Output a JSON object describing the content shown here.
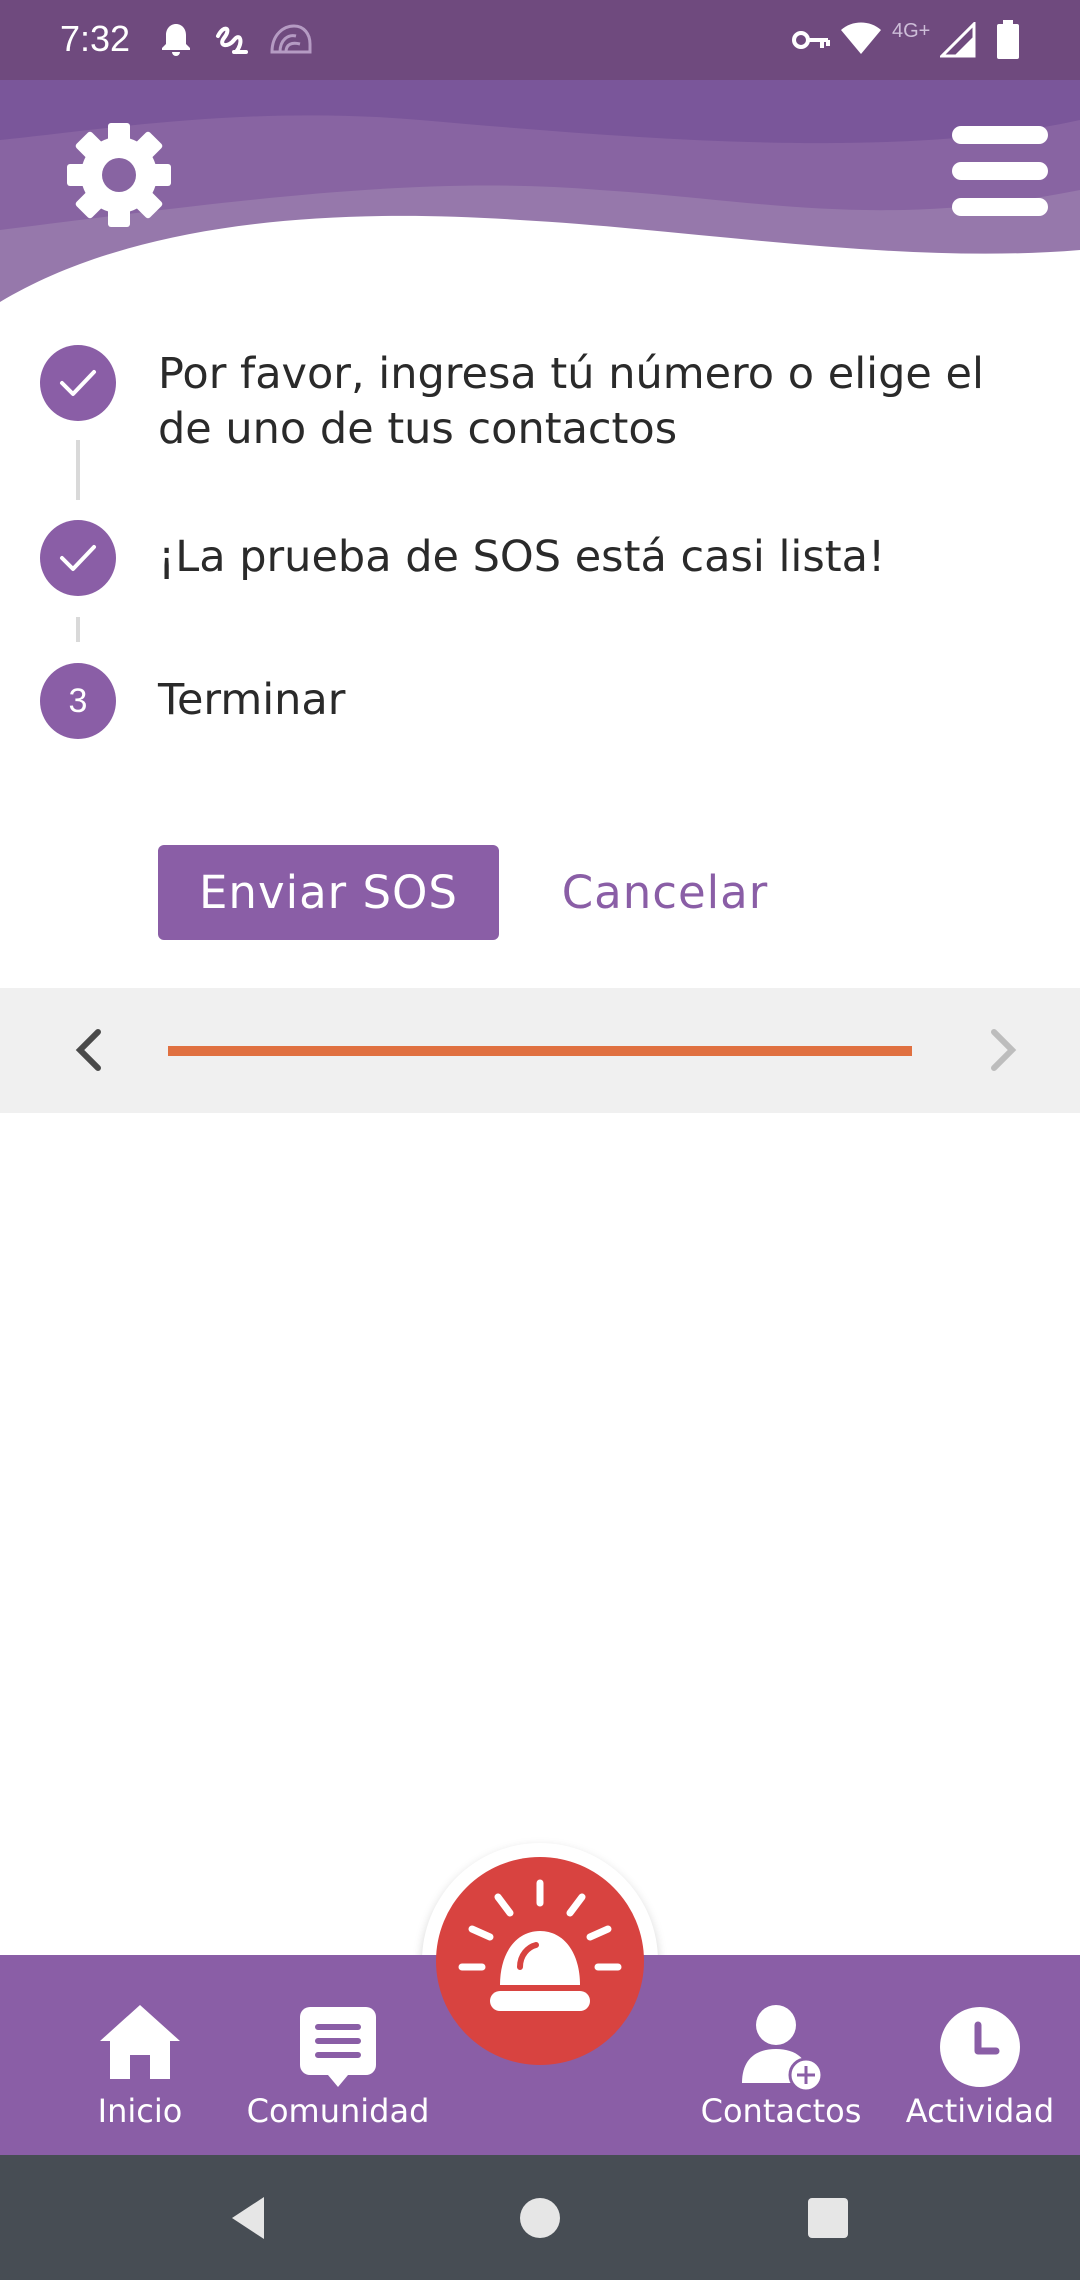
{
  "status_bar": {
    "time": "7:32",
    "network_label": "4G+",
    "icons": [
      "bell-icon",
      "squiggle-icon",
      "shell-icon",
      "vpn-key-icon",
      "wifi-icon",
      "signal-icon",
      "battery-icon"
    ]
  },
  "header": {
    "settings_icon": "gear-icon",
    "menu_icon": "hamburger-menu-icon",
    "colors": {
      "primary": "#8a5ea6",
      "status_bar": "#6f4a7e"
    }
  },
  "steps": [
    {
      "marker": "check",
      "label": "Por favor, ingresa tú número o elige el de uno de tus contactos"
    },
    {
      "marker": "check",
      "label": "¡La prueba de SOS está casi lista!"
    },
    {
      "marker": "3",
      "label": "Terminar"
    }
  ],
  "actions": {
    "send_label": "Enviar SOS",
    "cancel_label": "Cancelar"
  },
  "pager": {
    "progress": 1.0,
    "progress_color": "#e07040"
  },
  "sos_button": {
    "icon": "siren-icon",
    "color": "#d84340"
  },
  "bottom_nav": {
    "items": [
      {
        "label": "Inicio",
        "icon": "home-icon"
      },
      {
        "label": "Comunidad",
        "icon": "chat-icon"
      },
      {
        "label": "Contactos",
        "icon": "add-contact-icon"
      },
      {
        "label": "Actividad",
        "icon": "clock-icon"
      }
    ]
  },
  "system_nav": {
    "icons": [
      "back-icon",
      "home-circle-icon",
      "recents-icon"
    ]
  }
}
